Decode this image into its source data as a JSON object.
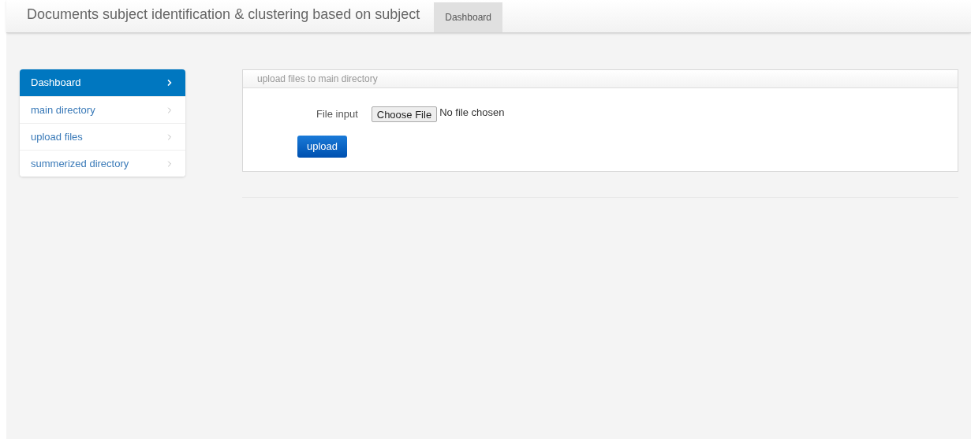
{
  "navbar": {
    "title": "Documents subject identification & clustering based on subject",
    "tabs": [
      {
        "label": "Dashboard",
        "selected": true
      }
    ]
  },
  "sidebar": {
    "items": [
      {
        "label": "Dashboard",
        "selected": true
      },
      {
        "label": "main directory",
        "selected": false
      },
      {
        "label": "upload files",
        "selected": false
      },
      {
        "label": "summerized directory",
        "selected": false
      }
    ]
  },
  "panel": {
    "title": "upload files to main directory",
    "field_label": "File input",
    "file_button": "Choose File",
    "file_status": "No file chosen",
    "submit": "upload"
  }
}
